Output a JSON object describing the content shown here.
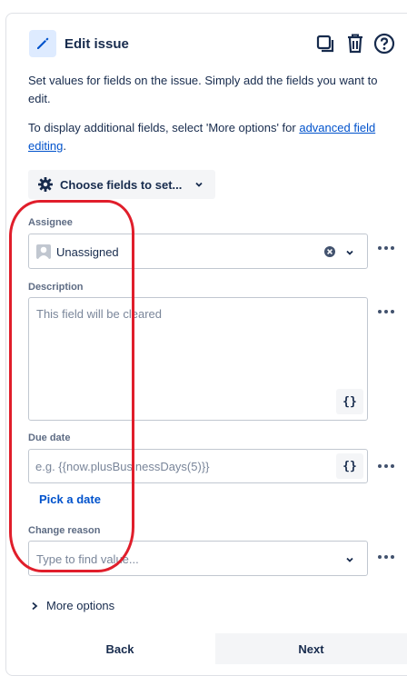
{
  "header": {
    "title": "Edit issue",
    "icons": [
      "pencil-icon",
      "copy-icon",
      "trash-icon",
      "help-icon"
    ]
  },
  "intro": {
    "text1": "Set values for fields on the issue. Simply add the fields you want to edit.",
    "text2_prefix": "To display additional fields, select 'More options' for ",
    "text2_link": "advanced field editing",
    "text2_suffix": "."
  },
  "choose_fields": {
    "label": "Choose fields to set..."
  },
  "assignee": {
    "label": "Assignee",
    "value": "Unassigned"
  },
  "description": {
    "label": "Description",
    "placeholder": "This field will be cleared",
    "brace": "{}"
  },
  "due_date": {
    "label": "Due date",
    "placeholder": "e.g. {{now.plusBusinessDays(5)}}",
    "brace": "{}",
    "pick_link": "Pick a date"
  },
  "change_reason": {
    "label": "Change reason",
    "placeholder": "Type to find value..."
  },
  "more_options": {
    "label": "More options"
  },
  "footer": {
    "back": "Back",
    "next": "Next"
  },
  "colors": {
    "link": "#0052cc",
    "annotation": "#e01e2b",
    "text": "#172b4d"
  }
}
